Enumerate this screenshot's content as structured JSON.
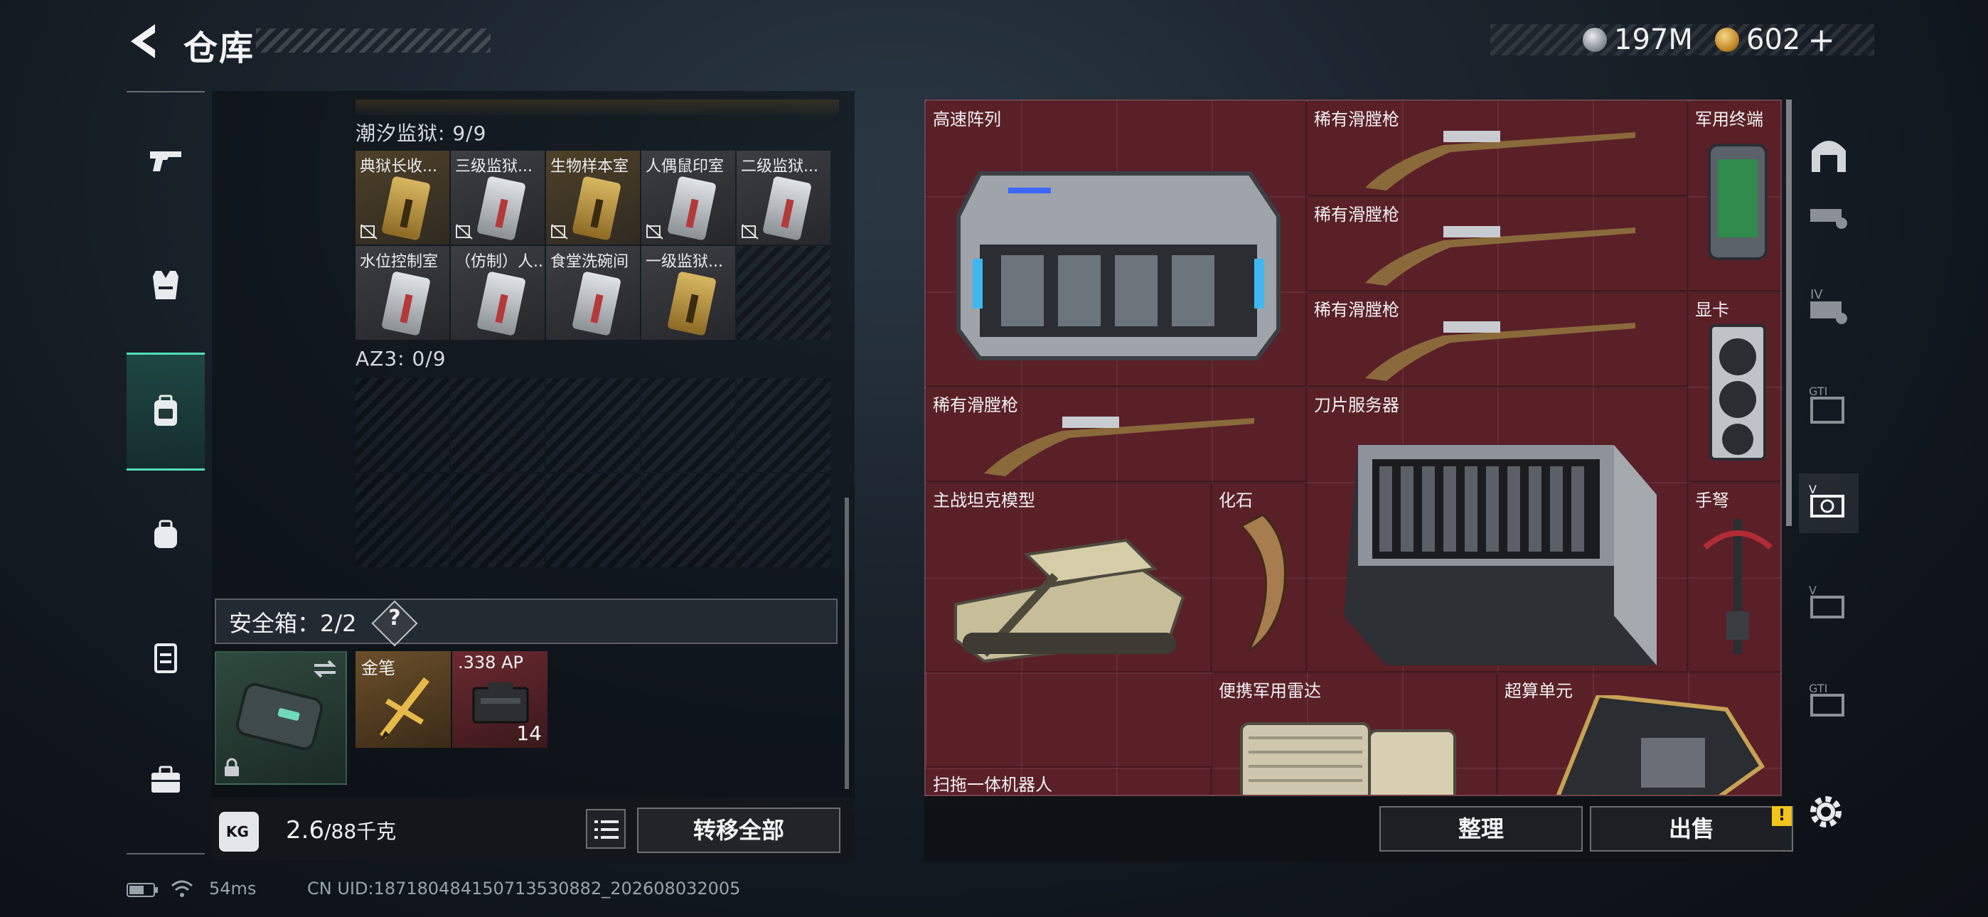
{
  "header": {
    "title": "仓库",
    "currency_silver": "197M",
    "currency_gold": "602",
    "currency_gold_plus": "+"
  },
  "left_nav": {
    "items": [
      "pistol-icon",
      "vest-icon",
      "backpack-icon",
      "bag-icon",
      "case-icon",
      "toolbox-icon"
    ],
    "active_index": 2
  },
  "inventory": {
    "section1": {
      "label": "潮汐监狱: 9/9",
      "cells": [
        {
          "name": "典狱长收...",
          "style": "gold",
          "card": "gold"
        },
        {
          "name": "三级监狱...",
          "style": "grey",
          "card": "silver"
        },
        {
          "name": "生物样本室",
          "style": "gold",
          "card": "gold"
        },
        {
          "name": "人偶鼠印室",
          "style": "grey",
          "card": "silver"
        },
        {
          "name": "二级监狱...",
          "style": "grey",
          "card": "silver"
        },
        {
          "name": "水位控制室",
          "style": "grey",
          "card": "silver"
        },
        {
          "name": "（仿制）人...",
          "style": "grey",
          "card": "silver"
        },
        {
          "name": "食堂洗碗间",
          "style": "grey",
          "card": "silver"
        },
        {
          "name": "一级监狱...",
          "style": "grey",
          "card": "gold"
        }
      ]
    },
    "section2": {
      "label": "AZ3: 0/9"
    },
    "safe_box": {
      "label": "安全箱：2/2",
      "help": "?",
      "items": [
        {
          "name": "金笔"
        },
        {
          "name": ".338 AP",
          "count": "14"
        }
      ]
    },
    "weight": {
      "kg": "KG",
      "current": "2.6",
      "max": "/88千克"
    },
    "transfer_all": "转移全部"
  },
  "stash": {
    "items": [
      {
        "name": "高速阵列"
      },
      {
        "name": "稀有滑膛枪"
      },
      {
        "name": "军用终端"
      },
      {
        "name": "稀有滑膛枪"
      },
      {
        "name": "稀有滑膛枪"
      },
      {
        "name": "显卡"
      },
      {
        "name": "稀有滑膛枪"
      },
      {
        "name": "刀片服务器"
      },
      {
        "name": "主战坦克模型"
      },
      {
        "name": "化石"
      },
      {
        "name": "手弩"
      },
      {
        "name": "便携军用雷达"
      },
      {
        "name": "超算单元"
      },
      {
        "name": "扫拖一体机器人"
      }
    ],
    "sort_button": "整理",
    "sell_button": "出售",
    "warning": "!"
  },
  "status_bar": {
    "ping": "54ms",
    "uid": "CN UID:18718048415071353088​2_202608032005"
  },
  "colors": {
    "accent": "#52e0b8",
    "stash_bg": "#5a2028",
    "warning": "#f3c21b"
  }
}
